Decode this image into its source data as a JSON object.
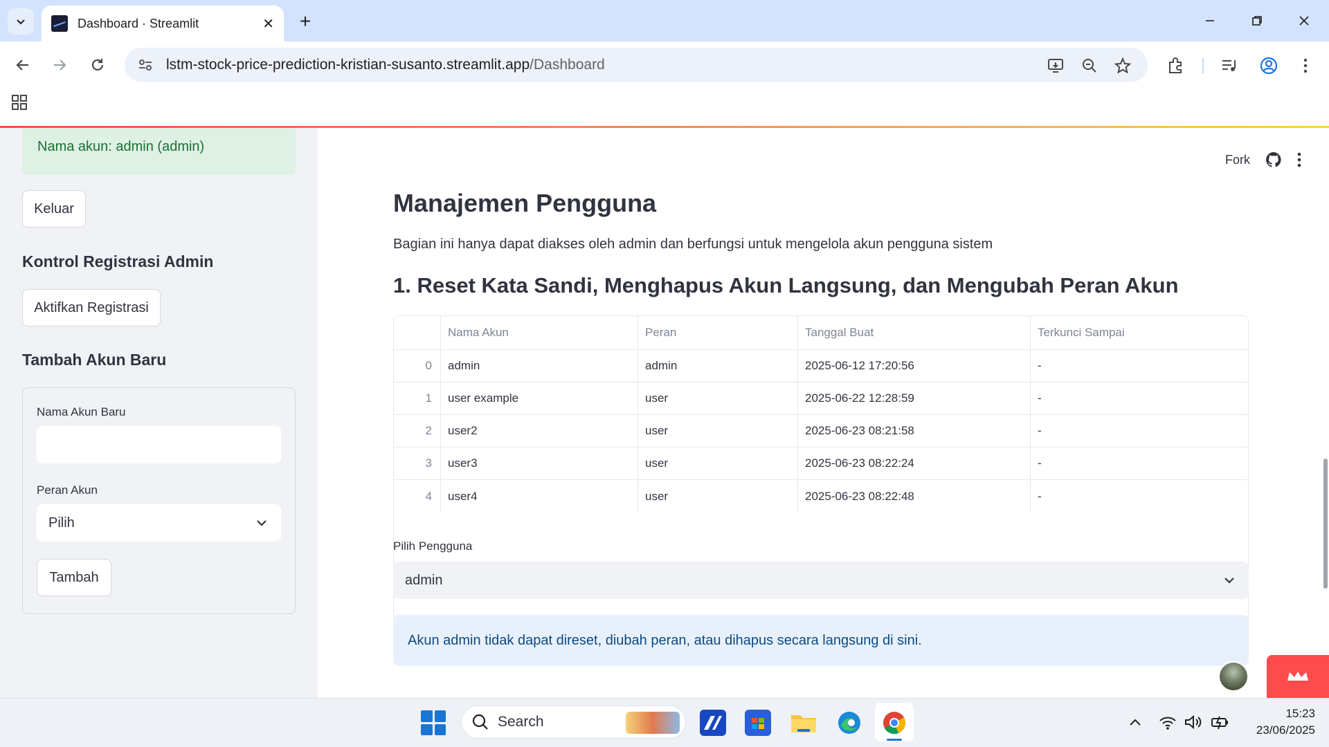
{
  "browser": {
    "tab_title": "Dashboard · Streamlit",
    "url_host": "lstm-stock-price-prediction-kristian-susanto.streamlit.app",
    "url_path": "/Dashboard"
  },
  "header": {
    "fork_label": "Fork"
  },
  "sidebar": {
    "account_status": "Nama akun: admin (admin)",
    "logout_label": "Keluar",
    "registration_heading": "Kontrol Registrasi Admin",
    "registration_button": "Aktifkan Registrasi",
    "new_account_heading": "Tambah Akun Baru",
    "form": {
      "username_label": "Nama Akun Baru",
      "username_value": "",
      "role_label": "Peran Akun",
      "role_value": "Pilih",
      "submit_label": "Tambah"
    }
  },
  "main": {
    "title": "Manajemen Pengguna",
    "description": "Bagian ini hanya dapat diakses oleh admin dan berfungsi untuk mengelola akun pengguna sistem",
    "section_title": "1. Reset Kata Sandi, Menghapus Akun Langsung, dan Mengubah Peran Akun",
    "table": {
      "columns": [
        "",
        "Nama Akun",
        "Peran",
        "Tanggal Buat",
        "Terkunci Sampai"
      ],
      "rows": [
        [
          "0",
          "admin",
          "admin",
          "2025-06-12 17:20:56",
          "-"
        ],
        [
          "1",
          "user example",
          "user",
          "2025-06-22 12:28:59",
          "-"
        ],
        [
          "2",
          "user2",
          "user",
          "2025-06-23 08:21:58",
          "-"
        ],
        [
          "3",
          "user3",
          "user",
          "2025-06-23 08:22:24",
          "-"
        ],
        [
          "4",
          "user4",
          "user",
          "2025-06-23 08:22:48",
          "-"
        ]
      ]
    },
    "select_user_label": "Pilih Pengguna",
    "select_user_value": "admin",
    "info_message": "Akun admin tidak dapat direset, diubah peran, atau dihapus secara langsung di sini."
  },
  "taskbar": {
    "search_label": "Search",
    "time": "15:23",
    "date": "23/06/2025"
  },
  "colors": {
    "streamlit_red": "#ff4b4b",
    "success_bg": "#dff0e4",
    "success_text": "#177233",
    "info_bg": "#e8f1fb",
    "info_text": "#0b4a85",
    "sidebar_bg": "#f0f2f6",
    "chrome_tabbar": "#d3e3fd"
  },
  "icons": [
    "tab-search-icon",
    "close-icon",
    "plus-icon",
    "minimize-icon",
    "restore-icon",
    "back-icon",
    "forward-icon",
    "reload-icon",
    "site-settings-icon",
    "install-app-icon",
    "zoom-icon",
    "star-icon",
    "extensions-icon",
    "media-icon",
    "profile-icon",
    "menu-icon",
    "apps-icon",
    "github-icon",
    "kebab-icon",
    "chevron-down-icon",
    "windows-start-icon",
    "search-icon",
    "wifi-icon",
    "volume-icon",
    "battery-icon"
  ]
}
